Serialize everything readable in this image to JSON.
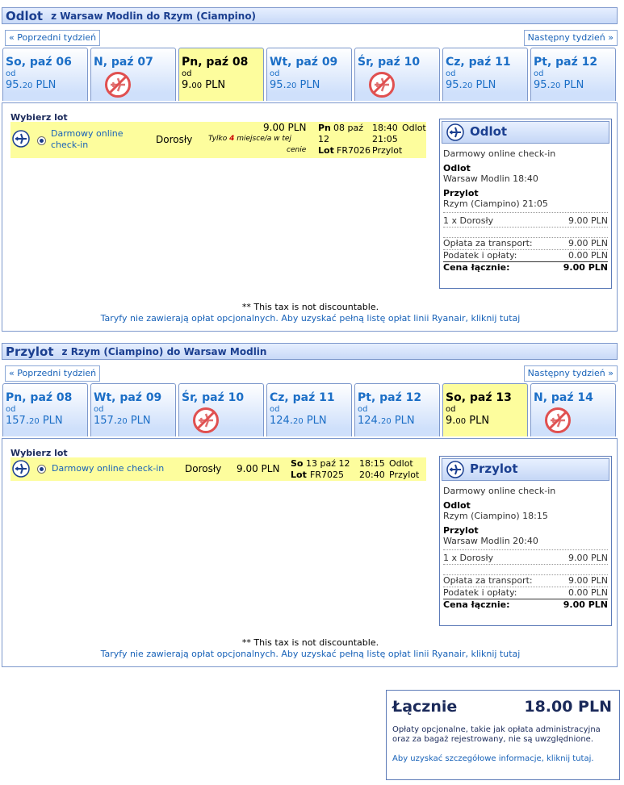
{
  "outbound": {
    "title": "Odlot",
    "route": "z Warsaw Modlin do Rzym (Ciampino)",
    "prev_week": "« Poprzedni tydzień",
    "next_week": "Następny tydzień »",
    "days": [
      {
        "label": "So, paź 06",
        "od": "od",
        "price_main": "95.",
        "price_dec": "20",
        "currency": " PLN",
        "available": true,
        "selected": false
      },
      {
        "label": "N, paź 07",
        "available": false,
        "selected": false
      },
      {
        "label": "Pn, paź 08",
        "od": "od",
        "price_main": "9.",
        "price_dec": "00",
        "currency": " PLN",
        "available": true,
        "selected": true
      },
      {
        "label": "Wt, paź 09",
        "od": "od",
        "price_main": "95.",
        "price_dec": "20",
        "currency": " PLN",
        "available": true,
        "selected": false
      },
      {
        "label": "Śr, paź 10",
        "available": false,
        "selected": false
      },
      {
        "label": "Cz, paź 11",
        "od": "od",
        "price_main": "95.",
        "price_dec": "20",
        "currency": " PLN",
        "available": true,
        "selected": false
      },
      {
        "label": "Pt, paź 12",
        "od": "od",
        "price_main": "95.",
        "price_dec": "20",
        "currency": " PLN",
        "available": true,
        "selected": false
      }
    ],
    "choose_label": "Wybierz lot",
    "flight": {
      "fare_line1": "Darmowy online",
      "fare_line2": "check-in",
      "passenger": "Dorosły",
      "price": "9.00 PLN",
      "seats_pre": "Tylko ",
      "seats_num": "4",
      "seats_post1": " miejsce/a w tej",
      "seats_post2": "cenie",
      "day_abbr": "Pn",
      "date_line1": "08 paź",
      "date_line2": "12",
      "lot_label": "Lot",
      "flight_no": "FR7026",
      "dep_time": "18:40",
      "dep_label": "Odlot",
      "arr_time": "21:05",
      "arr_label": "Przylot"
    },
    "summary": {
      "title": "Odlot",
      "fare": "Darmowy online check-in",
      "dep_heading": "Odlot",
      "dep_value": "Warsaw Modlin 18:40",
      "arr_heading": "Przylot",
      "arr_value": "Rzym (Ciampino) 21:05",
      "pax_label": "1 x Dorosły",
      "pax_value": "9.00 PLN",
      "transport_label": "Opłata za transport:",
      "transport_value": "9.00 PLN",
      "tax_label": "Podatek i opłaty:",
      "tax_value": "0.00 PLN",
      "total_label": "Cena łącznie:",
      "total_value": "9.00 PLN"
    },
    "tax_note": "** This tax is not discountable.",
    "fees_link": "Taryfy nie zawierają opłat opcjonalnych. Aby uzyskać pełną listę opłat linii Ryanair, kliknij tutaj"
  },
  "inbound": {
    "title": "Przylot",
    "route": "z Rzym (Ciampino) do Warsaw Modlin",
    "prev_week": "« Poprzedni tydzień",
    "next_week": "Następny tydzień »",
    "days": [
      {
        "label": "Pn, paź 08",
        "od": "od",
        "price_main": "157.",
        "price_dec": "20",
        "currency": " PLN",
        "available": true,
        "selected": false
      },
      {
        "label": "Wt, paź 09",
        "od": "od",
        "price_main": "157.",
        "price_dec": "20",
        "currency": " PLN",
        "available": true,
        "selected": false
      },
      {
        "label": "Śr, paź 10",
        "available": false,
        "selected": false
      },
      {
        "label": "Cz, paź 11",
        "od": "od",
        "price_main": "124.",
        "price_dec": "20",
        "currency": " PLN",
        "available": true,
        "selected": false
      },
      {
        "label": "Pt, paź 12",
        "od": "od",
        "price_main": "124.",
        "price_dec": "20",
        "currency": " PLN",
        "available": true,
        "selected": false
      },
      {
        "label": "So, paź 13",
        "od": "od",
        "price_main": "9.",
        "price_dec": "00",
        "currency": " PLN",
        "available": true,
        "selected": true
      },
      {
        "label": "N, paź 14",
        "available": false,
        "selected": false
      }
    ],
    "choose_label": "Wybierz lot",
    "flight": {
      "fare": "Darmowy online check-in",
      "passenger": "Dorosły",
      "price": "9.00 PLN",
      "day_abbr": "So",
      "date": "13 paź 12",
      "lot_label": "Lot",
      "flight_no": "FR7025",
      "dep_time": "18:15",
      "dep_label": "Odlot",
      "arr_time": "20:40",
      "arr_label": "Przylot"
    },
    "summary": {
      "title": "Przylot",
      "fare": "Darmowy online check-in",
      "dep_heading": "Odlot",
      "dep_value": "Rzym (Ciampino) 18:15",
      "arr_heading": "Przylot",
      "arr_value": "Warsaw Modlin 20:40",
      "pax_label": "1 x Dorosły",
      "pax_value": "9.00 PLN",
      "transport_label": "Opłata za transport:",
      "transport_value": "9.00 PLN",
      "tax_label": "Podatek i opłaty:",
      "tax_value": "0.00 PLN",
      "total_label": "Cena łącznie:",
      "total_value": "9.00 PLN"
    },
    "tax_note": "** This tax is not discountable.",
    "fees_link": "Taryfy nie zawierają opłat opcjonalnych. Aby uzyskać pełną listę opłat linii Ryanair, kliknij tutaj"
  },
  "total": {
    "label": "Łącznie",
    "value": "18.00 PLN",
    "note": "Opłaty opcjonalne, takie jak opłata administracyjna oraz za bagaż rejestrowany, nie są uwzględnione.",
    "link": "Aby uzyskać szczegółowe informacje, kliknij tutaj."
  },
  "icons": {
    "plane": "plane-icon",
    "no_flight": "no-flight-icon",
    "radio": "radio-selected"
  },
  "colors": {
    "accent": "#1b3f90",
    "link": "#1862b8",
    "selected_bg": "#fdfd9d",
    "alert": "#cc0000",
    "no_flight": "#e05050"
  }
}
